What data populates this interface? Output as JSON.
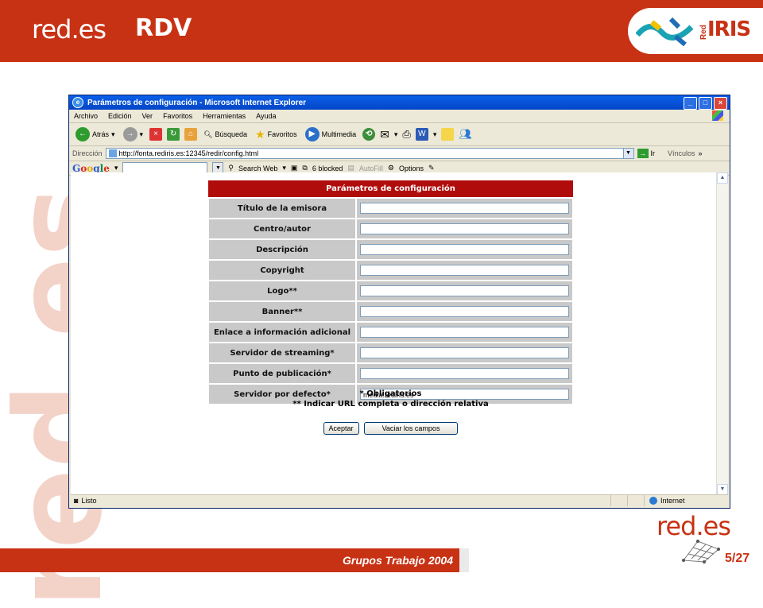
{
  "slide": {
    "logo_left": "red.es",
    "title": "RDV",
    "rediris_red": "Red",
    "rediris_iris": "IRIS",
    "watermark": "red.es",
    "footer_text": "Grupos Trabajo 2004",
    "logo_right": "red.es",
    "page_current": "5",
    "page_total": "/27",
    "colors": {
      "brand": "#c83214",
      "form_header": "#b10c0c",
      "label_bg": "#c9c9c9"
    }
  },
  "browser": {
    "title": "Parámetros de configuración - Microsoft Internet Explorer",
    "menu": [
      "Archivo",
      "Edición",
      "Ver",
      "Favoritos",
      "Herramientas",
      "Ayuda"
    ],
    "toolbar": {
      "back": "Atrás",
      "search": "Búsqueda",
      "favorites": "Favoritos",
      "multimedia": "Multimedia"
    },
    "address_label": "Dirección",
    "address_url": "http://fonta.rediris.es:12345/redir/config.html",
    "go_label": "Ir",
    "links_label": "Vínculos",
    "google": {
      "search_web": "Search Web",
      "blocked": "6 blocked",
      "autofill": "AutoFill",
      "options": "Options"
    },
    "status_text": "Listo",
    "zone": "Internet"
  },
  "form": {
    "header": "Parámetros de configuración",
    "fields": [
      {
        "label": "Título de la emisora",
        "value": ""
      },
      {
        "label": "Centro/autor",
        "value": ""
      },
      {
        "label": "Descripción",
        "value": ""
      },
      {
        "label": "Copyright",
        "value": ""
      },
      {
        "label": "Logo**",
        "value": ""
      },
      {
        "label": "Banner**",
        "value": ""
      },
      {
        "label": "Enlace a información adicional",
        "value": ""
      },
      {
        "label": "Servidor de streaming*",
        "value": ""
      },
      {
        "label": "Punto de publicación*",
        "value": ""
      },
      {
        "label": "Servidor por defecto*",
        "value": "media.rediris.es"
      }
    ],
    "note1": "* Obligatorios",
    "note2": "** Indicar URL completa o dirección relativa",
    "accept_label": "Aceptar",
    "clear_label": "Vaciar los campos"
  }
}
